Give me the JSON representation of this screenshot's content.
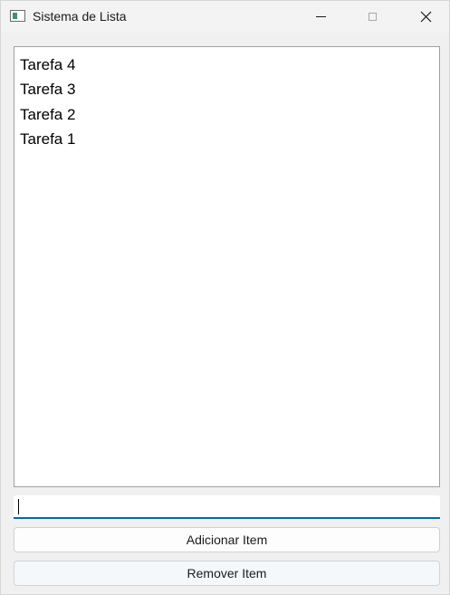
{
  "window": {
    "title": "Sistema de Lista"
  },
  "list": {
    "items": [
      {
        "label": "Tarefa 4"
      },
      {
        "label": "Tarefa 3"
      },
      {
        "label": "Tarefa 2"
      },
      {
        "label": "Tarefa 1"
      }
    ]
  },
  "input": {
    "value": ""
  },
  "buttons": {
    "add_label": "Adicionar Item",
    "remove_label": "Remover Item"
  },
  "colors": {
    "focus_accent": "#0067c0"
  }
}
